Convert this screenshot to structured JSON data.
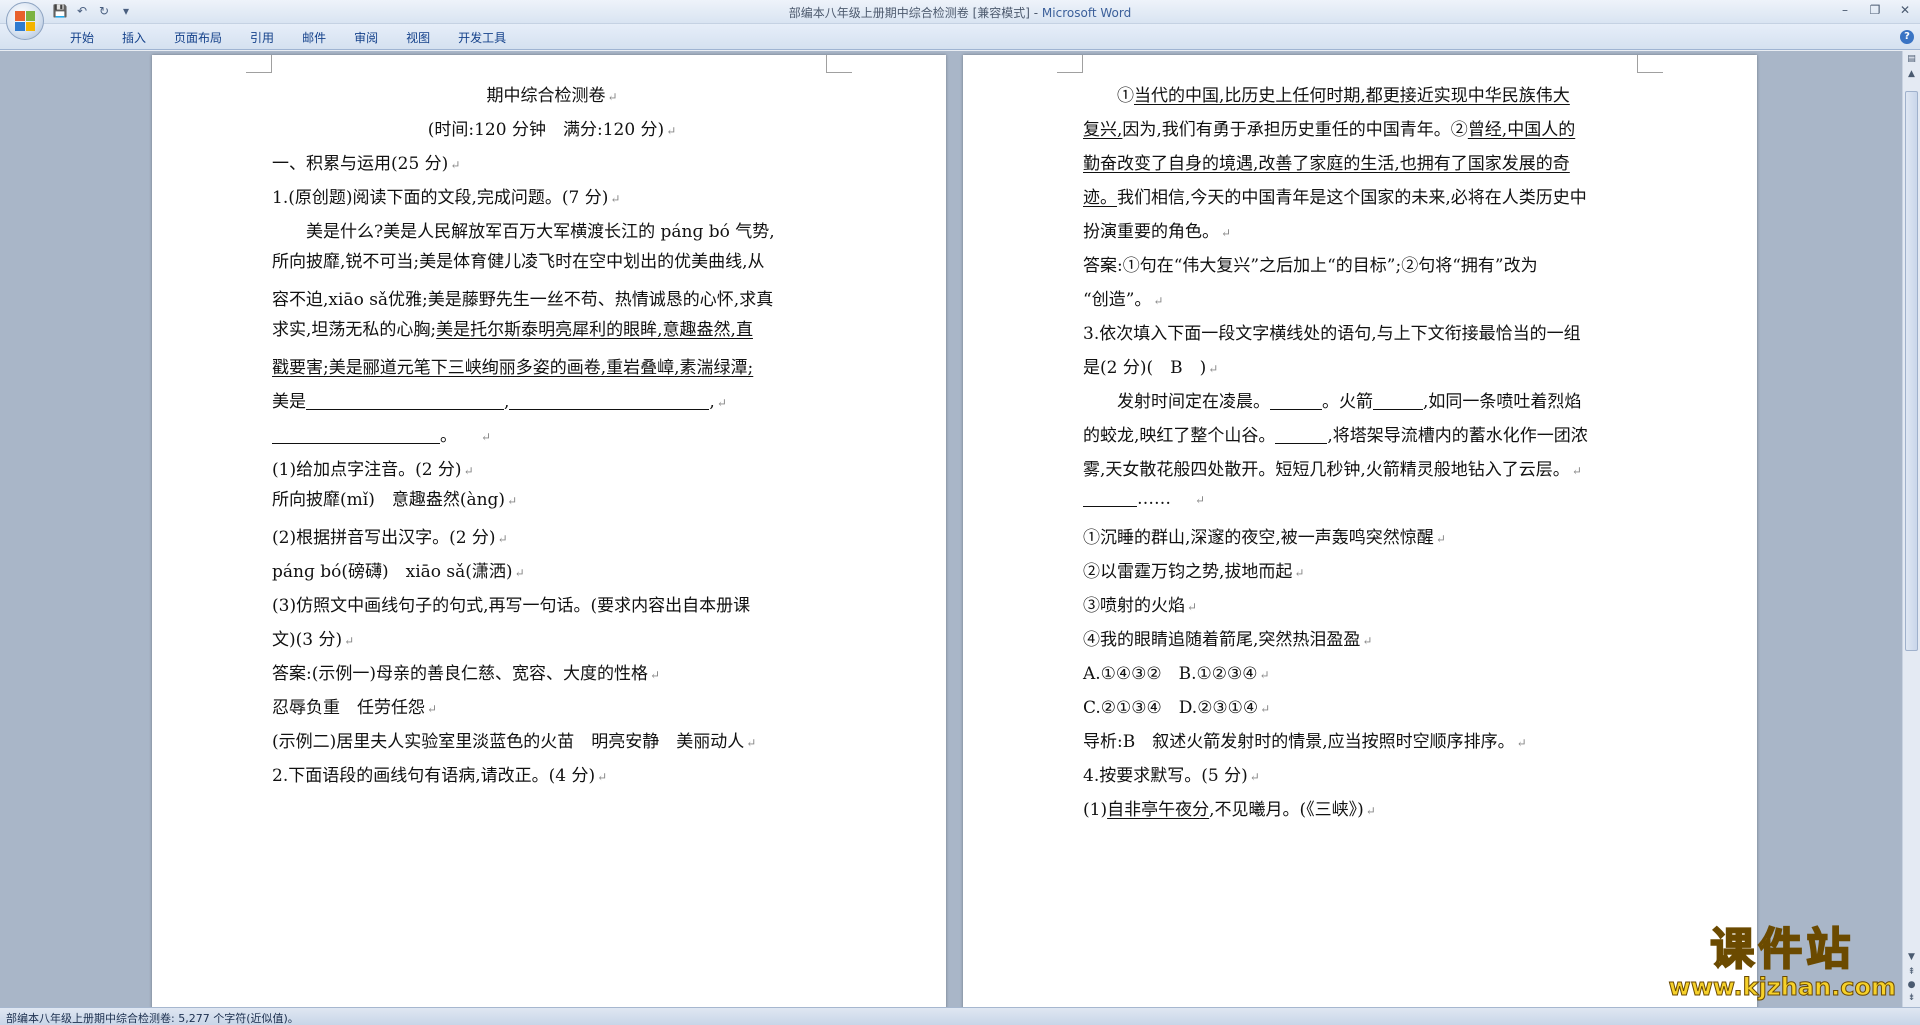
{
  "window": {
    "doc_title": "部编本八年级上册期中综合检测卷 [兼容模式] - ",
    "app_name": "Microsoft Word"
  },
  "ribbon": {
    "tabs": [
      "开始",
      "插入",
      "页面布局",
      "引用",
      "邮件",
      "审阅",
      "视图",
      "开发工具"
    ]
  },
  "left_page": {
    "title": "期中综合检测卷",
    "subtitle": "(时间:120 分钟　满分:120 分)",
    "l1": "一、积累与运用(25 分)",
    "l2": "1.(原创题)阅读下面的文段,完成问题。(7 分)",
    "l3": "　　美是什么?美是人民解放军百万大军横渡长江的 pánɡ bó 气势,",
    "l4": "所向披靡,锐不可当;美是体育健儿凌飞时在空中划出的优美曲线,从",
    "l5": "容不迫,xiāo sǎ优雅;美是藤野先生一丝不苟、热情诚恳的心怀,求真",
    "l6a": "求实,坦荡无私的心胸;",
    "l6b": "美是托尔斯泰明亮犀利的眼眸,意趣盎然,直",
    "l7": "戳要害;美是郦道元笔下三峡绚丽多姿的画卷,重岩叠嶂,素湍绿潭;",
    "l8a": "美是",
    "l8b": ",",
    "l8c": ",",
    "l9": "。",
    "l10": "(1)给加点字注音。(2 分)",
    "l11": "所向披靡(mǐ)　意趣盎然(àng)",
    "l12": "(2)根据拼音写出汉字。(2 分)",
    "l13": "pánɡ bó(磅礴)　xiāo sǎ(潇洒)",
    "l14": "(3)仿照文中画线句子的句式,再写一句话。(要求内容出自本册课",
    "l15": "文)(3 分)",
    "l16": "答案:(示例一)母亲的善良仁慈、宽容、大度的性格",
    "l17": "忍辱负重　任劳任怨",
    "l18": "(示例二)居里夫人实验室里淡蓝色的火苗　明亮安静　美丽动人",
    "l19": "2.下面语段的画线句有语病,请改正。(4 分)"
  },
  "right_page": {
    "r1a": "　　①",
    "r1b": "当代的中国,比历史上任何时期,都更接近实现中华民族伟大",
    "r2a": "复兴,",
    "r2b": "因为,我们有勇于承担历史重任的中国青年。②",
    "r2c": "曾经,中国人的",
    "r3": "勤奋改变了自身的境遇,改善了家庭的生活,也拥有了国家发展的奇",
    "r4a": "迹。",
    "r4b": "我们相信,今天的中国青年是这个国家的未来,必将在人类历史中",
    "r5": "扮演重要的角色。",
    "r6": "答案:①句在“伟大复兴”之后加上“的目标”;②句将“拥有”改为",
    "r7": "“创造”。",
    "r8": "3.依次填入下面一段文字横线处的语句,与上下文衔接最恰当的一组",
    "r9": "是(2 分)(　B　)",
    "r10a": "　　发射时间定在凌晨。",
    "r10b": "。火箭",
    "r10c": ",如同一条喷吐着烈焰",
    "r11a": "的蛟龙,映红了整个山谷。",
    "r11b": ",将塔架导流槽内的蓄水化作一团浓",
    "r12": "雾,天女散花般四处散开。短短几秒钟,火箭精灵般地钻入了云层。",
    "r13": "……",
    "r14": "①沉睡的群山,深邃的夜空,被一声轰鸣突然惊醒",
    "r15": "②以雷霆万钧之势,拔地而起",
    "r16": "③喷射的火焰",
    "r17": "④我的眼睛追随着箭尾,突然热泪盈盈",
    "r18": "A.①④③②　B.①②③④",
    "r19": "C.②①③④　D.②③①④",
    "r20": "导析:B　叙述火箭发射时的情景,应当按照时空顺序排序。",
    "r21": "4.按要求默写。(5 分)",
    "r22a": "(1)",
    "r22b": "自非亭午夜分",
    "r22c": ",不见曦月。(《三峡》)"
  },
  "status": {
    "text": "部编本八年级上册期中综合检测卷: 5,277 个字符(近似值)。"
  },
  "watermark": {
    "title": "课件站",
    "url": "www.kjzhan.com"
  }
}
